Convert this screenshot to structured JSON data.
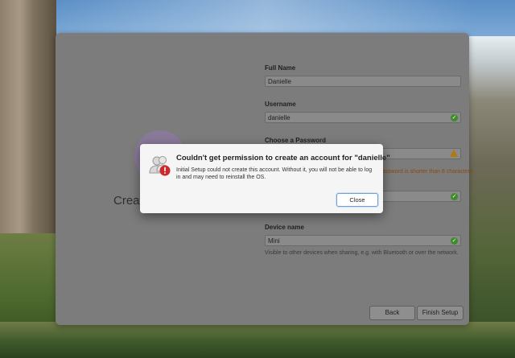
{
  "create_title": "Create",
  "form": {
    "full_name_label": "Full Name",
    "full_name_value": "Danielle",
    "username_label": "Username",
    "username_value": "danielle",
    "password_label": "Choose a Password",
    "password_warning": "Password is shorter than 8 characters",
    "device_label": "Device name",
    "device_value": "Mini",
    "device_hint": "Visible to other devices when sharing, e.g. with Bluetooth or over the network."
  },
  "buttons": {
    "back": "Back",
    "finish": "Finish Setup"
  },
  "dialog": {
    "title": "Couldn't get permission to create an account for \"danielle\"",
    "body": "Initial Setup could not create this account. Without it, you will not be able to log in and may need to reinstall the OS.",
    "close": "Close"
  }
}
